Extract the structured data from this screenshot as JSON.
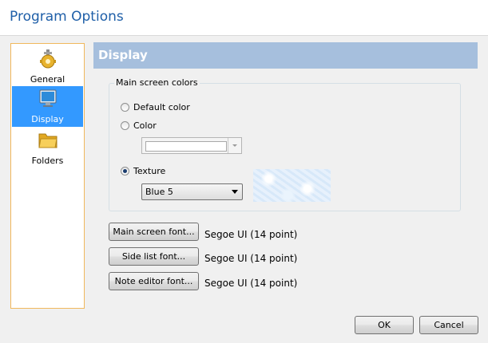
{
  "window": {
    "title": "Program Options"
  },
  "sidebar": {
    "items": [
      {
        "label": "General",
        "icon": "gear-icon",
        "selected": false
      },
      {
        "label": "Display",
        "icon": "monitor-icon",
        "selected": true
      },
      {
        "label": "Folders",
        "icon": "folder-icon",
        "selected": false
      }
    ]
  },
  "section": {
    "title": "Display"
  },
  "colors_group": {
    "legend": "Main screen colors",
    "default_color_label": "Default color",
    "color_label": "Color",
    "texture_label": "Texture",
    "selected_option": "Texture",
    "color_value": "#ffffff",
    "texture_value": "Blue 5"
  },
  "fonts": {
    "main_screen_button": "Main screen font...",
    "main_screen_value": "Segoe UI (14 point)",
    "side_list_button": "Side list font...",
    "side_list_value": "Segoe UI (14 point)",
    "note_editor_button": "Note editor font...",
    "note_editor_value": "Segoe UI (14 point)"
  },
  "footer": {
    "ok_label": "OK",
    "cancel_label": "Cancel"
  },
  "colors": {
    "accent": "#3399ff",
    "header_bg": "#a6bfdd",
    "title": "#1f5fa8",
    "sidebar_border": "#f0b85c"
  }
}
